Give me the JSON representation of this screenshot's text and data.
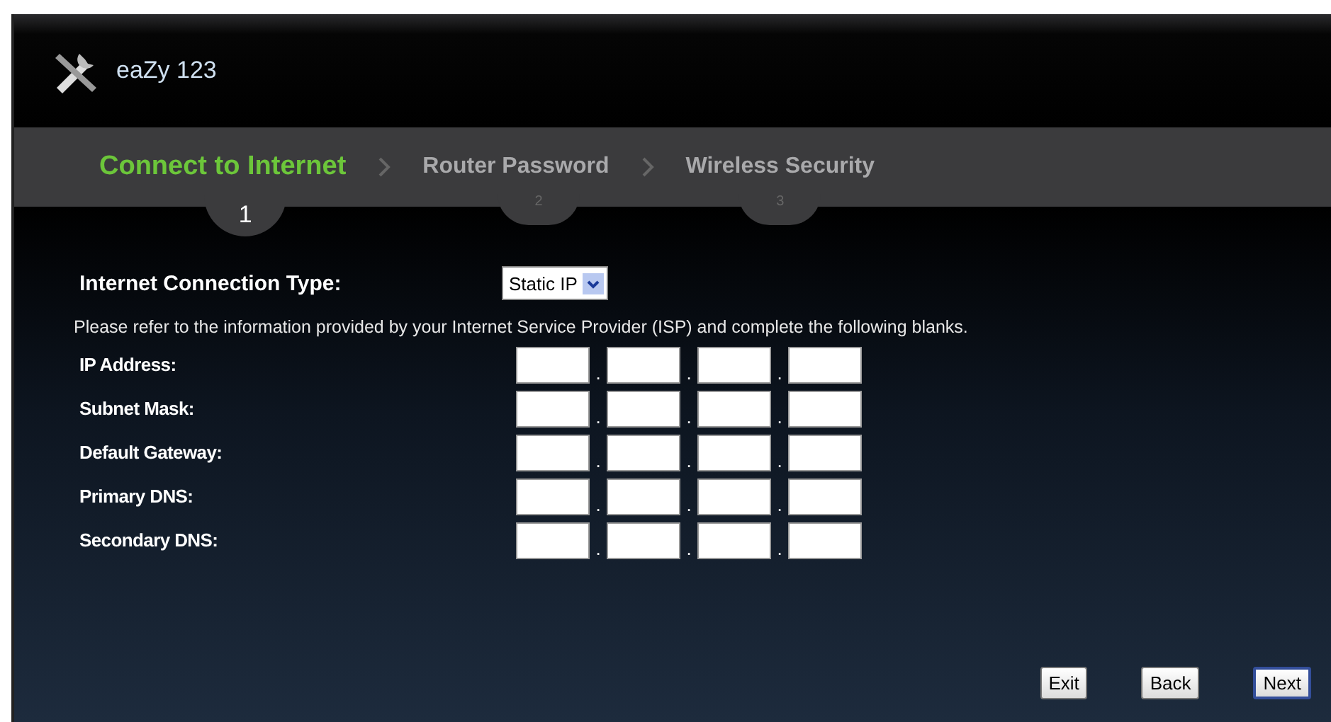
{
  "app": {
    "title": "eaZy 123"
  },
  "steps": [
    {
      "label": "Connect to Internet",
      "number": "1",
      "selected": true
    },
    {
      "label": "Router Password",
      "number": "2",
      "selected": false
    },
    {
      "label": "Wireless Security",
      "number": "3",
      "selected": false
    }
  ],
  "connection_type": {
    "label": "Internet Connection Type:",
    "value": "Static IP"
  },
  "instructions": "Please refer to the information provided by your Internet Service Provider (ISP) and complete the following blanks.",
  "fields": [
    {
      "label": "IP Address:",
      "separators": [
        ".",
        ".",
        "."
      ]
    },
    {
      "label": "Subnet Mask:",
      "separators": [
        ".",
        ".",
        "."
      ]
    },
    {
      "label": "Default Gateway:",
      "separators": [
        ".",
        ".",
        "."
      ]
    },
    {
      "label": "Primary DNS:",
      "separators": [
        ".",
        ".",
        "."
      ]
    },
    {
      "label": "Secondary DNS:",
      "separators": [
        ".",
        ".",
        "."
      ]
    }
  ],
  "buttons": [
    {
      "label": "Exit",
      "kind": "plain"
    },
    {
      "label": "Back",
      "kind": "plain"
    },
    {
      "label": "Next",
      "kind": "default"
    }
  ]
}
